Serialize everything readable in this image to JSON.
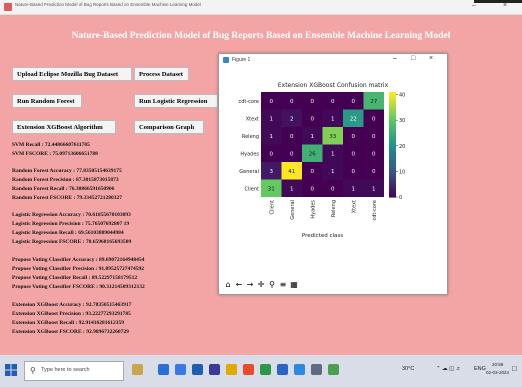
{
  "window": {
    "title": "Nature-Based Prediction Model of Bug Reports Based on Ensemble Machine Learning Model",
    "minimize": "–",
    "close": "×"
  },
  "header": {
    "title": "Nature-Based Prediction Model of Bug Reports Based on Ensemble Machine Learning Model"
  },
  "buttons": {
    "upload": "Upload Eclipse Mozilla Bug Dataset",
    "process": "Process Dataset",
    "random_forest": "Run Random Forest",
    "logistic": "Run Logistic Regression",
    "xgboost": "Extension XGBoost Algorithm",
    "comparison": "Comparison Graph"
  },
  "output_lines": [
    "SVM Recall   : 72.44866607611705",
    "SVM FSCORE   : 75.09713606651788",
    "Random Forest Accuracy  : 77.83505154639175",
    "Random Forest Precision : 87.3015873015873",
    "Random Forest Recall    : 76.30866591650906",
    "Random Forest FSCORE    : 79.33452721280327",
    "Logistic Regression Accuracy  : 70.61855670103093",
    "Logistic Regression Precision : 75.76507692807 19",
    "Logistic Regression Recall    : 69.56103809044984",
    "Logistic Regression FSCORE    : 70.65968165693509",
    "Propose Voting Classifier Accuracy  : 89.69072164948454",
    "Propose Voting Classifier Precision : 91.89525727474592",
    "Propose Voting Classifier Recall    : 89.52297158179512",
    "Propose Voting Classifier FSCORE    : 90.31214509312132",
    "Extension XGBoost Accuracy  : 92.78350515463917",
    "Extension XGBoost Precision : 93.22277293291785",
    "Extension XGBoost Recall    : 92.91416281612359",
    "Extension XGBoost FSCORE    : 92.9896732260729"
  ],
  "figure": {
    "window_title": "Figure 1",
    "minimize": "–",
    "maximize": "□",
    "close": "×",
    "toolbar_icons": [
      "home-icon",
      "back-icon",
      "forward-icon",
      "pan-icon",
      "zoom-icon",
      "configure-icon",
      "save-icon"
    ]
  },
  "chart_data": {
    "type": "heatmap",
    "title": "Extension XGBoost Confusion matrix",
    "xlabel": "Predicted class",
    "ylabel": "",
    "rows": [
      "cdt-core",
      "Xtext",
      "Releng",
      "Hyades",
      "General",
      "Client"
    ],
    "columns": [
      "Client",
      "General",
      "Hyades",
      "Releng",
      "Xtext",
      "cdt-core"
    ],
    "values": [
      [
        0,
        0,
        0,
        0,
        0,
        27
      ],
      [
        1,
        2,
        0,
        1,
        22,
        0
      ],
      [
        1,
        0,
        1,
        33,
        0,
        0
      ],
      [
        0,
        0,
        26,
        1,
        0,
        0
      ],
      [
        3,
        41,
        0,
        1,
        0,
        0
      ],
      [
        31,
        1,
        0,
        0,
        1,
        1
      ]
    ],
    "colorbar_ticks": [
      40,
      30,
      20,
      10,
      0
    ],
    "vmin": 0,
    "vmax": 41,
    "colormap": "viridis"
  },
  "taskbar": {
    "search_placeholder": "Type here to search",
    "weather": "30°C",
    "lang": "ENG",
    "time": "20:58",
    "date": "02-03-2024"
  }
}
